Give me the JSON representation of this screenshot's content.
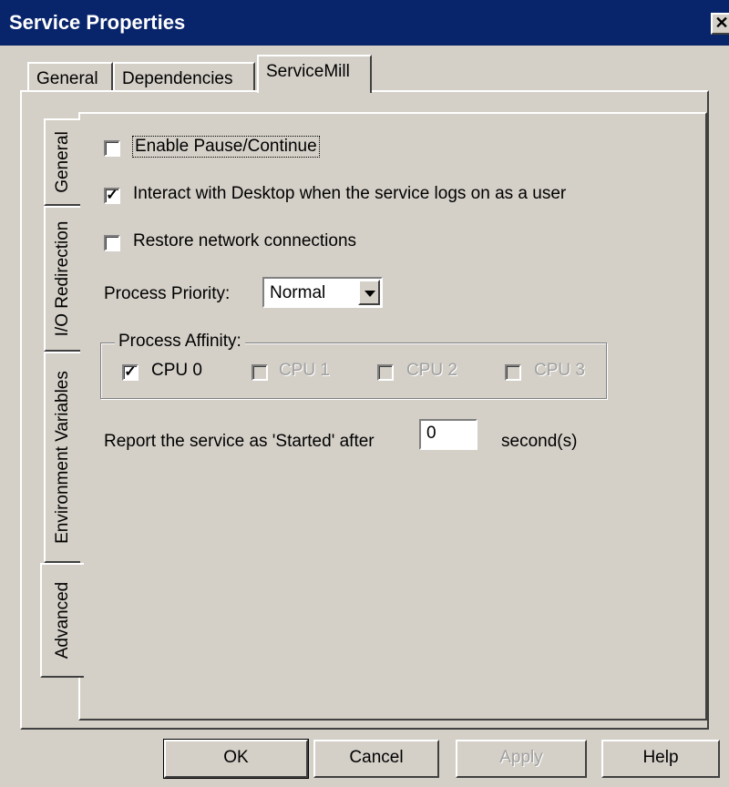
{
  "window": {
    "title": "Service Properties",
    "close_glyph": "✕"
  },
  "top_tabs": [
    {
      "label": "General"
    },
    {
      "label": "Dependencies"
    },
    {
      "label": "ServiceMill",
      "active": true
    }
  ],
  "side_tabs": [
    {
      "label": "General"
    },
    {
      "label": "I/O Redirection"
    },
    {
      "label": "Environment Variables"
    },
    {
      "label": "Advanced",
      "active": true
    }
  ],
  "options": {
    "enable_pause": {
      "label": "Enable Pause/Continue",
      "checked": false
    },
    "interact_desktop": {
      "label": "Interact with Desktop when the service logs on as a user",
      "checked": true
    },
    "restore_network": {
      "label": "Restore network connections",
      "checked": false
    }
  },
  "process_priority": {
    "label": "Process Priority:",
    "value": "Normal"
  },
  "process_affinity": {
    "title": "Process Affinity:",
    "cpus": [
      {
        "label": "CPU 0",
        "checked": true,
        "enabled": true
      },
      {
        "label": "CPU 1",
        "checked": false,
        "enabled": false
      },
      {
        "label": "CPU 2",
        "checked": false,
        "enabled": false
      },
      {
        "label": "CPU 3",
        "checked": false,
        "enabled": false
      }
    ]
  },
  "report_started": {
    "prefix": "Report the service as 'Started' after",
    "value": "0",
    "suffix": "second(s)"
  },
  "buttons": {
    "ok": "OK",
    "cancel": "Cancel",
    "apply": "Apply",
    "help": "Help"
  },
  "check_glyph": "✓"
}
